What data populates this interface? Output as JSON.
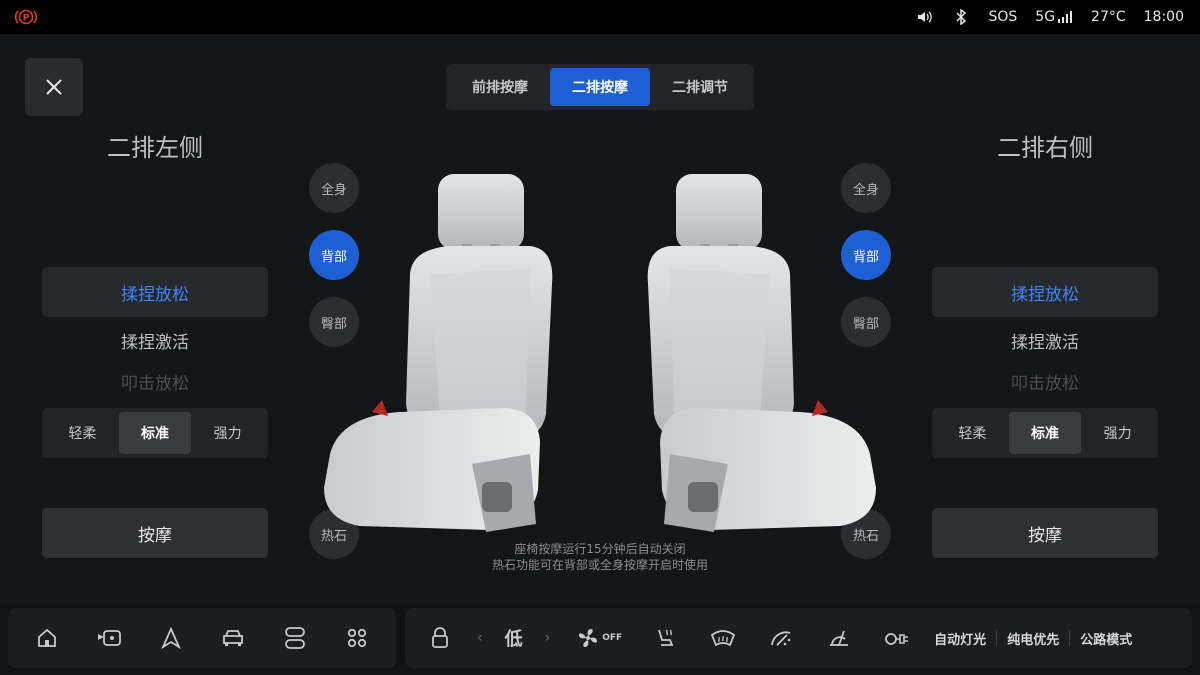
{
  "status": {
    "sos": "SOS",
    "network": "5G",
    "temperature": "27°C",
    "time": "18:00"
  },
  "tabs": [
    {
      "label": "前排按摩",
      "active": false
    },
    {
      "label": "二排按摩",
      "active": true
    },
    {
      "label": "二排调节",
      "active": false
    }
  ],
  "left": {
    "title": "二排左侧",
    "modes": [
      "揉捏放松",
      "揉捏激活",
      "叩击放松"
    ],
    "selected_mode": "揉捏放松",
    "intensity": [
      "轻柔",
      "标准",
      "强力"
    ],
    "selected_intensity": "标准",
    "massage_label": "按摩"
  },
  "right": {
    "title": "二排右侧",
    "modes": [
      "揉捏放松",
      "揉捏激活",
      "叩击放松"
    ],
    "selected_mode": "揉捏放松",
    "intensity": [
      "轻柔",
      "标准",
      "强力"
    ],
    "selected_intensity": "标准",
    "massage_label": "按摩"
  },
  "zones": {
    "full_body": "全身",
    "back": "背部",
    "hip": "臀部",
    "hot_stone": "热石",
    "selected": "背部"
  },
  "hint": {
    "line1": "座椅按摩运行15分钟后自动关闭",
    "line2": "热石功能可在背部或全身按摩开启时使用"
  },
  "dock": {
    "fan_level": "低",
    "fan_state": "OFF",
    "auto_light": "自动灯光",
    "ev_priority": "纯电优先",
    "road_mode": "公路模式"
  },
  "colors": {
    "accent": "#1f5fd6",
    "accent_text": "#3d86ff",
    "parking_red": "#e03a2f"
  }
}
